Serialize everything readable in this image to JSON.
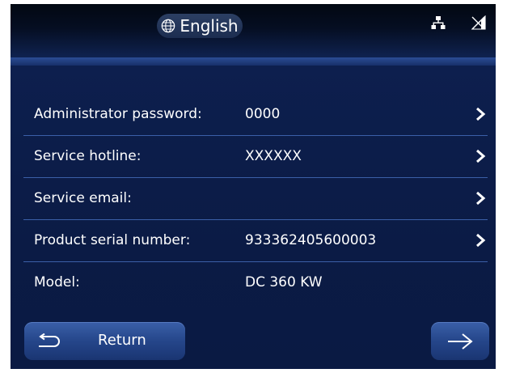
{
  "header": {
    "language_label": "English",
    "icons": {
      "language": "globe-icon",
      "network": "network-icon",
      "signal": "no-signal-icon"
    }
  },
  "info_rows": [
    {
      "label": "Administrator password:",
      "value": "0000",
      "has_arrow": true
    },
    {
      "label": "Service hotline:",
      "value": "XXXXXX",
      "has_arrow": true
    },
    {
      "label": "Service email:",
      "value": "",
      "has_arrow": true
    },
    {
      "label": "Product serial number:",
      "value": "933362405600003",
      "has_arrow": true
    },
    {
      "label": "Model:",
      "value": "DC 360 KW",
      "has_arrow": false
    }
  ],
  "footer": {
    "return_label": "Return",
    "icons": {
      "return": "return-arrow-icon",
      "next": "right-arrow-icon"
    }
  },
  "colors": {
    "background": "#0b1a42",
    "header": "#050e22",
    "separator": "#3b5fa8",
    "button": "#25468a",
    "text": "#ffffff"
  }
}
